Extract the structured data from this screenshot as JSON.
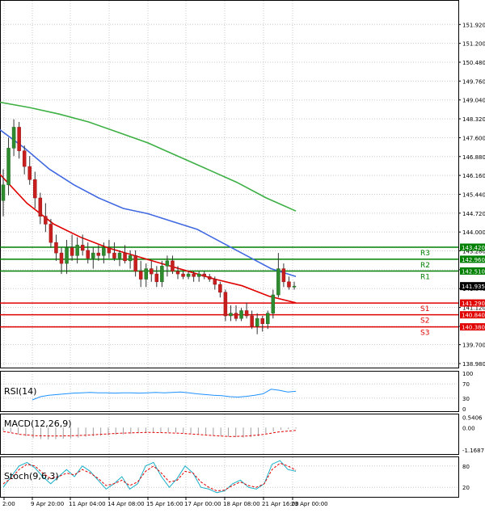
{
  "chart_data": [
    {
      "type": "candlestick",
      "panel": "price",
      "ylim": [
        138.98,
        152.7
      ],
      "y_ticks": [
        "151.920",
        "151.200",
        "150.480",
        "149.760",
        "149.040",
        "148.320",
        "147.600",
        "146.880",
        "146.160",
        "145.440",
        "144.720",
        "144.000",
        "143.280",
        "142.560",
        "141.840",
        "141.120",
        "140.400",
        "139.700",
        "138.980"
      ],
      "x_ticks": [
        "2:00",
        "9 Apr 20:00",
        "11 Apr 04:00",
        "14 Apr 08:00",
        "15 Apr 16:00",
        "17 Apr 00:00",
        "18 Apr 08:00",
        "21 Apr 16:00",
        "23 Apr 00:00"
      ],
      "current_price": "141.935",
      "levels": [
        {
          "name": "R3",
          "value": 143.42,
          "label": "143.420",
          "color": "#008000"
        },
        {
          "name": "R2",
          "value": 142.96,
          "label": "142.960",
          "color": "#008000"
        },
        {
          "name": "R1",
          "value": 142.51,
          "label": "142.510",
          "color": "#008000"
        },
        {
          "name": "S1",
          "value": 141.29,
          "label": "141.290",
          "color": "#e00000"
        },
        {
          "name": "S2",
          "value": 140.84,
          "label": "140.840",
          "color": "#e00000"
        },
        {
          "name": "S3",
          "value": 140.38,
          "label": "140.380",
          "color": "#e00000"
        }
      ],
      "candles": [
        [
          145.2,
          146.4,
          144.6,
          145.8
        ],
        [
          145.8,
          147.6,
          145.4,
          147.2
        ],
        [
          147.2,
          148.3,
          146.9,
          148.0
        ],
        [
          148.0,
          148.2,
          146.8,
          147.1
        ],
        [
          147.1,
          147.3,
          146.2,
          146.5
        ],
        [
          146.5,
          146.9,
          145.8,
          146.0
        ],
        [
          146.0,
          146.3,
          144.9,
          145.3
        ],
        [
          145.3,
          145.5,
          144.3,
          144.6
        ],
        [
          144.6,
          145.1,
          144.0,
          144.3
        ],
        [
          144.3,
          144.5,
          143.4,
          143.6
        ],
        [
          143.6,
          143.9,
          142.9,
          143.2
        ],
        [
          143.2,
          143.4,
          142.4,
          142.8
        ],
        [
          142.8,
          143.7,
          142.4,
          143.4
        ],
        [
          143.4,
          143.9,
          142.9,
          143.1
        ],
        [
          143.1,
          143.8,
          142.8,
          143.5
        ],
        [
          143.5,
          143.9,
          143.1,
          143.3
        ],
        [
          143.3,
          143.6,
          142.8,
          143.0
        ],
        [
          143.0,
          143.4,
          142.6,
          143.2
        ],
        [
          143.2,
          143.5,
          142.9,
          143.1
        ],
        [
          143.1,
          143.6,
          142.8,
          143.4
        ],
        [
          143.4,
          143.7,
          143.0,
          143.2
        ],
        [
          143.2,
          143.6,
          142.9,
          143.0
        ],
        [
          143.0,
          143.3,
          142.7,
          143.2
        ],
        [
          143.2,
          143.5,
          142.8,
          142.9
        ],
        [
          142.9,
          143.3,
          142.6,
          143.1
        ],
        [
          143.1,
          143.3,
          142.3,
          142.5
        ],
        [
          142.5,
          142.9,
          141.9,
          142.2
        ],
        [
          142.2,
          142.8,
          141.9,
          142.6
        ],
        [
          142.6,
          142.9,
          142.1,
          142.4
        ],
        [
          142.4,
          142.7,
          141.9,
          142.1
        ],
        [
          142.1,
          142.9,
          141.9,
          142.7
        ],
        [
          142.7,
          143.1,
          142.3,
          142.9
        ],
        [
          142.9,
          143.1,
          142.4,
          142.5
        ],
        [
          142.5,
          142.7,
          142.2,
          142.4
        ],
        [
          142.4,
          142.5,
          142.2,
          142.3
        ],
        [
          142.3,
          142.5,
          142.2,
          142.4
        ],
        [
          142.4,
          142.5,
          142.1,
          142.3
        ],
        [
          142.3,
          142.5,
          142.1,
          142.4
        ],
        [
          142.4,
          142.5,
          142.2,
          142.3
        ],
        [
          142.3,
          142.4,
          142.1,
          142.2
        ],
        [
          142.2,
          142.3,
          141.8,
          142.0
        ],
        [
          142.0,
          142.1,
          141.5,
          141.7
        ],
        [
          141.7,
          141.8,
          140.6,
          140.8
        ],
        [
          140.8,
          141.2,
          140.6,
          140.9
        ],
        [
          140.9,
          141.2,
          140.6,
          140.7
        ],
        [
          140.7,
          141.1,
          140.6,
          141.0
        ],
        [
          141.0,
          141.3,
          140.7,
          140.8
        ],
        [
          140.8,
          141.0,
          140.3,
          140.4
        ],
        [
          140.4,
          140.9,
          140.1,
          140.7
        ],
        [
          140.7,
          140.8,
          140.2,
          140.5
        ],
        [
          140.5,
          141.0,
          140.3,
          140.9
        ],
        [
          140.9,
          141.8,
          140.7,
          141.6
        ],
        [
          141.6,
          143.2,
          141.5,
          142.6
        ],
        [
          142.6,
          142.8,
          141.9,
          142.1
        ],
        [
          142.1,
          142.3,
          141.8,
          141.9
        ],
        [
          141.9,
          142.1,
          141.8,
          141.935
        ]
      ],
      "ma_fast": [
        146.2,
        145.1,
        144.3,
        143.8,
        143.4,
        143.1,
        142.8,
        142.5,
        142.2,
        141.95,
        141.55,
        141.3
      ],
      "ma_mid": [
        147.9,
        147.2,
        146.4,
        145.8,
        145.3,
        144.9,
        144.7,
        144.4,
        144.1,
        143.6,
        143.1,
        142.6,
        142.3
      ],
      "ma_slow": [
        148.95,
        148.75,
        148.5,
        148.2,
        147.8,
        147.4,
        146.9,
        146.4,
        145.9,
        145.3,
        144.8
      ]
    },
    {
      "type": "line",
      "panel": "rsi",
      "title": "RSI(14)",
      "ylim": [
        0,
        100
      ],
      "y_ticks": [
        "100",
        "70",
        "30",
        "0"
      ],
      "values": [
        25,
        34,
        38,
        40,
        42,
        44,
        45,
        46,
        45,
        45,
        44,
        45,
        45,
        44,
        45,
        46,
        45,
        46,
        47,
        45,
        42,
        40,
        38,
        37,
        34,
        33,
        35,
        38,
        42,
        55,
        52,
        47,
        49
      ]
    },
    {
      "type": "bar",
      "panel": "macd",
      "title": "MACD(12,26,9)",
      "ylim": [
        -1.25,
        0.6
      ],
      "y_ticks": [
        "0.5406",
        "0.00",
        "-1.1687"
      ],
      "histogram": [
        -0.15,
        -0.25,
        -0.35,
        -0.45,
        -0.55,
        -0.6,
        -0.62,
        -0.6,
        -0.58,
        -0.56,
        -0.52,
        -0.48,
        -0.45,
        -0.43,
        -0.41,
        -0.38,
        -0.35,
        -0.32,
        -0.3,
        -0.28,
        -0.26,
        -0.25,
        -0.25,
        -0.26,
        -0.28,
        -0.3,
        -0.33,
        -0.36,
        -0.4,
        -0.44,
        -0.47,
        -0.5,
        -0.52,
        -0.5,
        -0.45,
        -0.3,
        -0.2,
        -0.12,
        -0.08,
        -0.05
      ],
      "signal": [
        -0.2,
        -0.35,
        -0.42,
        -0.44,
        -0.43,
        -0.4,
        -0.35,
        -0.3,
        -0.27,
        -0.25,
        -0.27,
        -0.3,
        -0.36,
        -0.42,
        -0.47,
        -0.44,
        -0.36,
        -0.22,
        -0.15
      ]
    },
    {
      "type": "line",
      "panel": "stoch",
      "title": "Stoch(9,6,3)",
      "ylim": [
        0,
        100
      ],
      "y_ticks": [
        "80",
        "20"
      ],
      "k_line": [
        20,
        50,
        80,
        90,
        75,
        50,
        30,
        50,
        70,
        50,
        80,
        65,
        40,
        15,
        30,
        50,
        15,
        30,
        80,
        90,
        50,
        20,
        45,
        80,
        60,
        20,
        15,
        5,
        10,
        30,
        40,
        20,
        15,
        30,
        85,
        95,
        70,
        65
      ],
      "d_line": [
        30,
        45,
        70,
        85,
        80,
        60,
        45,
        50,
        60,
        55,
        70,
        60,
        45,
        25,
        30,
        40,
        25,
        35,
        65,
        80,
        60,
        35,
        40,
        65,
        60,
        35,
        20,
        10,
        12,
        25,
        35,
        25,
        20,
        30,
        70,
        88,
        80,
        68
      ]
    }
  ]
}
